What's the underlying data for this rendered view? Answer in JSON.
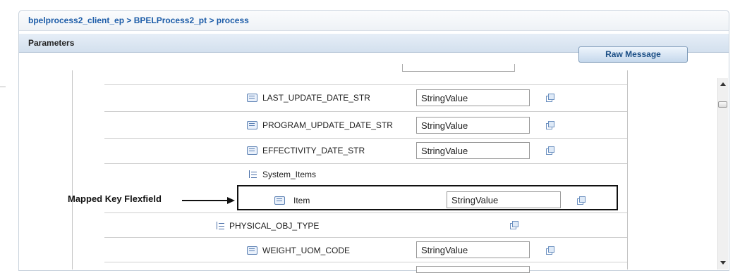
{
  "breadcrumb": "bpelprocess2_client_ep > BPELProcess2_pt > process",
  "section_title": "Parameters",
  "raw_message_button": "Raw Message",
  "annotation": "Mapped Key Flexfield",
  "rows": [
    {
      "label": "LAST_UPDATE_DATE_STR",
      "value": "StringValue",
      "icon": "field-icon"
    },
    {
      "label": "PROGRAM_UPDATE_DATE_STR",
      "value": "StringValue",
      "icon": "field-icon"
    },
    {
      "label": "EFFECTIVITY_DATE_STR",
      "value": "StringValue",
      "icon": "field-icon"
    },
    {
      "label": "System_Items",
      "icon": "tree-icon"
    },
    {
      "label": "Item",
      "value": "StringValue",
      "icon": "field-icon"
    },
    {
      "label": "PHYSICAL_OBJ_TYPE",
      "icon": "tree-icon"
    },
    {
      "label": "WEIGHT_UOM_CODE",
      "value": "StringValue",
      "icon": "field-icon"
    }
  ]
}
